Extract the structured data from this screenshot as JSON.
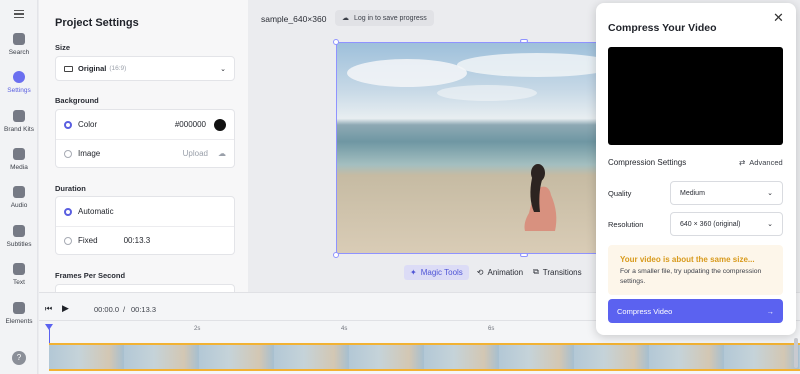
{
  "rail": {
    "menu_icon": "hamburger-icon",
    "items": [
      {
        "label": "Search",
        "icon": "search-icon"
      },
      {
        "label": "Settings",
        "icon": "settings-icon",
        "active": true
      },
      {
        "label": "Brand Kits",
        "icon": "brand-kits-icon"
      },
      {
        "label": "Media",
        "icon": "media-plus-icon"
      },
      {
        "label": "Audio",
        "icon": "music-note-icon"
      },
      {
        "label": "Subtitles",
        "icon": "subtitles-icon"
      },
      {
        "label": "Text",
        "icon": "text-t-icon"
      },
      {
        "label": "Elements",
        "icon": "elements-icon"
      }
    ],
    "help_icon": "help-question-icon"
  },
  "panel": {
    "title": "Project Settings",
    "size": {
      "label": "Size",
      "value": "Original",
      "hint": "(16:9)"
    },
    "background": {
      "label": "Background",
      "color_label": "Color",
      "color_value": "#000000",
      "image_label": "Image",
      "upload_label": "Upload"
    },
    "duration": {
      "label": "Duration",
      "automatic": "Automatic",
      "fixed": "Fixed",
      "fixed_value": "00:13.3"
    },
    "fps_label": "Frames Per Second"
  },
  "topbar": {
    "file_name": "sample_640×360",
    "login_label": "Log in to save progress"
  },
  "tools": {
    "magic": "Magic Tools",
    "animation": "Animation",
    "transitions": "Transitions"
  },
  "playback": {
    "current": "00:00.0",
    "separator": "/",
    "total": "00:13.3",
    "ticks": [
      "2s",
      "4s",
      "6s"
    ]
  },
  "modal": {
    "title": "Compress Your Video",
    "settings_heading": "Compression Settings",
    "advanced_label": "Advanced",
    "quality_label": "Quality",
    "quality_value": "Medium",
    "resolution_label": "Resolution",
    "resolution_value": "640 × 360 (original)",
    "notice_title": "Your video is about the same size...",
    "notice_body": "For a smaller file, try updating the compression settings.",
    "cta_label": "Compress Video"
  },
  "colors": {
    "accent": "#5b62f0",
    "notice": "#d89a1c",
    "timeline_border": "#f2b233"
  }
}
